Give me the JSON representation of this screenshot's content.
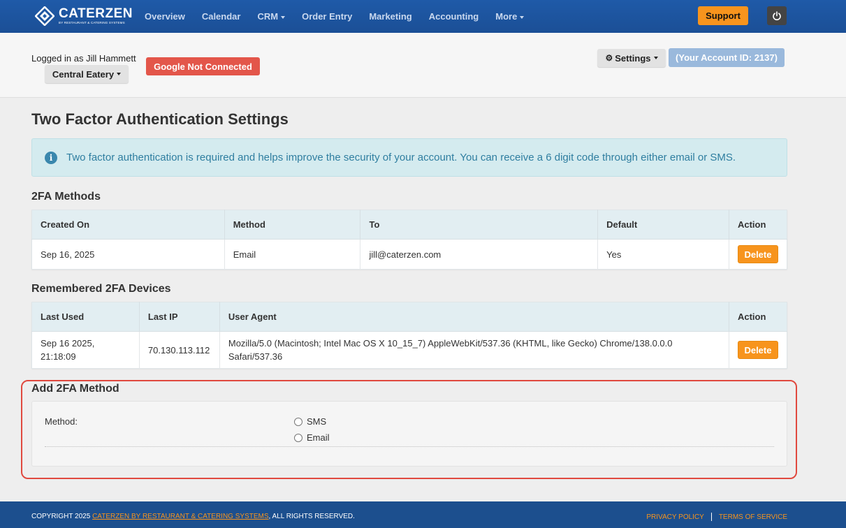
{
  "brand": {
    "name": "CATERZEN",
    "subtitle": "BY RESTAURANT & CATERING SYSTEMS"
  },
  "nav": {
    "items": [
      {
        "label": "Overview"
      },
      {
        "label": "Calendar"
      },
      {
        "label": "CRM"
      },
      {
        "label": "Order Entry"
      },
      {
        "label": "Marketing"
      },
      {
        "label": "Accounting"
      },
      {
        "label": "More"
      }
    ],
    "support_label": "Support"
  },
  "account": {
    "logged_in_text": "Logged in as Jill Hammett",
    "restaurant": "Central Eatery",
    "google_status": "Google Not Connected",
    "settings_label": "Settings",
    "account_id_text": "(Your Account ID: 2137)"
  },
  "page": {
    "title": "Two Factor Authentication Settings",
    "info_text": "Two factor authentication is required and helps improve the security of your account. You can receive a 6 digit code through either email or SMS."
  },
  "methods": {
    "title": "2FA Methods",
    "columns": [
      "Created On",
      "Method",
      "To",
      "Default",
      "Action"
    ],
    "rows": [
      {
        "created_on": "Sep 16, 2025",
        "method": "Email",
        "to": "jill@caterzen.com",
        "default": "Yes",
        "action": "Delete"
      }
    ]
  },
  "devices": {
    "title": "Remembered 2FA Devices",
    "columns": [
      "Last Used",
      "Last IP",
      "User Agent",
      "Action"
    ],
    "rows": [
      {
        "last_used": "Sep 16 2025, 21:18:09",
        "last_ip": "70.130.113.112",
        "user_agent": "Mozilla/5.0 (Macintosh; Intel Mac OS X 10_15_7) AppleWebKit/537.36 (KHTML, like Gecko) Chrome/138.0.0.0 Safari/537.36",
        "action": "Delete"
      }
    ]
  },
  "add_method": {
    "title": "Add 2FA Method",
    "label": "Method:",
    "options": [
      "SMS",
      "Email"
    ]
  },
  "footer": {
    "copyright_prefix": "COPYRIGHT 2025 ",
    "company_link": "CATERZEN BY RESTAURANT & CATERING SYSTEMS",
    "copyright_suffix": ", ALL RIGHTS RESERVED.",
    "privacy": "PRIVACY POLICY",
    "terms": "TERMS OF SERVICE"
  },
  "colors": {
    "nav_bg": "#1f5aa8",
    "accent_orange": "#f7941d",
    "danger_red": "#e3564a",
    "info_bg": "#d4ebef",
    "highlight_border": "#e0493f"
  }
}
